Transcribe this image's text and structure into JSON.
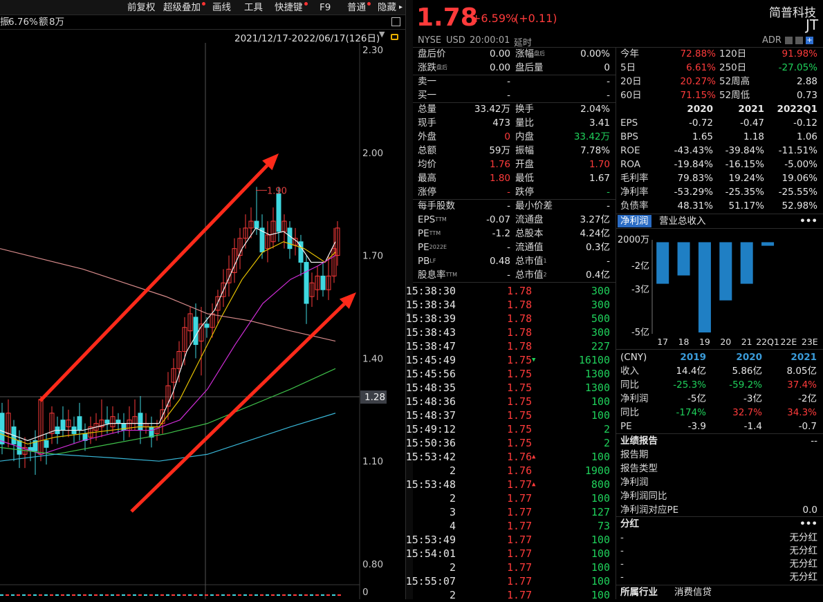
{
  "toolbar": {
    "items": [
      "前复权",
      "超级叠加",
      "画线",
      "工具",
      "快捷键",
      "F9",
      "普通",
      "隐藏"
    ]
  },
  "info_line": {
    "turnover_rate": "6.76%",
    "amount_label": "额",
    "amount": "8万",
    "prefix": "振"
  },
  "range_bar": {
    "range": "2021/12/17-2022/06/17(126日)"
  },
  "chart": {
    "y_ticks": [
      "2.30",
      "2.00",
      "1.70",
      "1.40",
      "1.10",
      "0.80",
      "0"
    ],
    "current_price_tag": "1.28",
    "high_marker": "1.90",
    "up_color": "#ff3b3b",
    "down_color": "#3fd8e0",
    "arrow_color": "#ff2a1a"
  },
  "quote": {
    "price": "1.78",
    "change_pct": "+6.59%",
    "change": "(+0.11)",
    "exchange": "NYSE",
    "currency": "USD",
    "time": "20:00:01",
    "delay": "延时",
    "name": "简普科技",
    "ticker": "JT",
    "adr": "ADR"
  },
  "left_table": [
    {
      "l1": "盘后价",
      "v1": "0.00",
      "c1": "white",
      "l2": "涨幅",
      "s2": "盘后",
      "v2": "0.00%",
      "c2": "white"
    },
    {
      "l1": "涨跌",
      "s1": "盘后",
      "v1": "0.00",
      "c1": "white",
      "l2": "盘后量",
      "v2": "0",
      "c2": "white"
    },
    {
      "l1": "卖一",
      "v1": "-",
      "c1": "white",
      "l2": "",
      "v2": "-",
      "c2": "white"
    },
    {
      "l1": "买一",
      "v1": "-",
      "c1": "white",
      "l2": "",
      "v2": "-",
      "c2": "white"
    },
    {
      "l1": "总量",
      "v1": "33.42万",
      "c1": "white",
      "l2": "换手",
      "v2": "2.04%",
      "c2": "white"
    },
    {
      "l1": "现手",
      "v1": "473",
      "c1": "white",
      "l2": "量比",
      "v2": "3.41",
      "c2": "white"
    },
    {
      "l1": "外盘",
      "v1": "0",
      "c1": "red",
      "l2": "内盘",
      "v2": "33.42万",
      "c2": "green"
    },
    {
      "l1": "总额",
      "v1": "59万",
      "c1": "white",
      "l2": "振幅",
      "v2": "7.78%",
      "c2": "white"
    },
    {
      "l1": "均价",
      "v1": "1.76",
      "c1": "red",
      "l2": "开盘",
      "v2": "1.70",
      "c2": "red"
    },
    {
      "l1": "最高",
      "v1": "1.80",
      "c1": "red",
      "l2": "最低",
      "v2": "1.67",
      "c2": "white"
    },
    {
      "l1": "涨停",
      "v1": "-",
      "c1": "red",
      "l2": "跌停",
      "v2": "-",
      "c2": "green"
    },
    {
      "l1": "每手股数",
      "v1": "-",
      "c1": "white",
      "l2": "最小价差",
      "v2": "-",
      "c2": "white"
    },
    {
      "l1": "EPS",
      "s1": "TTM",
      "v1": "-0.07",
      "c1": "white",
      "l2": "流通盘",
      "v2": "3.27亿",
      "c2": "white"
    },
    {
      "l1": "PE",
      "s1": "TTM",
      "v1": "-1.2",
      "c1": "white",
      "l2": "总股本",
      "v2": "4.24亿",
      "c2": "white"
    },
    {
      "l1": "PE",
      "s1": "2022E",
      "v1": "-",
      "c1": "white",
      "l2": "流通值",
      "v2": "0.3亿",
      "c2": "white"
    },
    {
      "l1": "PB",
      "s1": "LF",
      "v1": "0.48",
      "c1": "white",
      "l2": "总市值",
      "s2": "1",
      "v2": "-",
      "c2": "white"
    },
    {
      "l1": "股息率",
      "s1": "TTM",
      "v1": "-",
      "c1": "white",
      "l2": "总市值",
      "s2": "2",
      "v2": "0.4亿",
      "c2": "white"
    }
  ],
  "trades": [
    {
      "t": "15:38:30",
      "p": "1.78",
      "a": "",
      "v": "300"
    },
    {
      "t": "15:38:34",
      "p": "1.78",
      "a": "",
      "v": "300"
    },
    {
      "t": "15:38:39",
      "p": "1.78",
      "a": "",
      "v": "500"
    },
    {
      "t": "15:38:43",
      "p": "1.78",
      "a": "",
      "v": "300"
    },
    {
      "t": "15:38:47",
      "p": "1.78",
      "a": "",
      "v": "227"
    },
    {
      "t": "15:45:49",
      "p": "1.75",
      "a": "down",
      "v": "16100"
    },
    {
      "t": "15:45:56",
      "p": "1.75",
      "a": "",
      "v": "1300"
    },
    {
      "t": "15:48:35",
      "p": "1.75",
      "a": "",
      "v": "1300"
    },
    {
      "t": "15:48:36",
      "p": "1.75",
      "a": "",
      "v": "100"
    },
    {
      "t": "15:48:37",
      "p": "1.75",
      "a": "",
      "v": "100"
    },
    {
      "t": "15:49:12",
      "p": "1.75",
      "a": "",
      "v": "2"
    },
    {
      "t": "15:50:36",
      "p": "1.75",
      "a": "",
      "v": "2"
    },
    {
      "t": "15:53:42",
      "p": "1.76",
      "a": "up",
      "v": "100"
    },
    {
      "t": "2",
      "p": "1.76",
      "a": "",
      "v": "1900"
    },
    {
      "t": "15:53:48",
      "p": "1.77",
      "a": "up",
      "v": "800"
    },
    {
      "t": "2",
      "p": "1.77",
      "a": "",
      "v": "100"
    },
    {
      "t": "3",
      "p": "1.77",
      "a": "",
      "v": "127"
    },
    {
      "t": "4",
      "p": "1.77",
      "a": "",
      "v": "73"
    },
    {
      "t": "15:53:49",
      "p": "1.77",
      "a": "",
      "v": "100"
    },
    {
      "t": "15:54:01",
      "p": "1.77",
      "a": "",
      "v": "100"
    },
    {
      "t": "2",
      "p": "1.77",
      "a": "",
      "v": "100"
    },
    {
      "t": "15:55:07",
      "p": "1.77",
      "a": "",
      "v": "100"
    },
    {
      "t": "2",
      "p": "1.77",
      "a": "",
      "v": "100"
    }
  ],
  "perf": [
    {
      "l1": "今年",
      "v1": "72.88%",
      "c1": "red",
      "l2": "120日",
      "v2": "91.98%",
      "c2": "red"
    },
    {
      "l1": "5日",
      "v1": "6.61%",
      "c1": "red",
      "l2": "250日",
      "v2": "-27.05%",
      "c2": "green"
    },
    {
      "l1": "20日",
      "v1": "20.27%",
      "c1": "red",
      "l2": "52周高",
      "v2": "2.88",
      "c2": "white"
    },
    {
      "l1": "60日",
      "v1": "71.15%",
      "c1": "red",
      "l2": "52周低",
      "v2": "0.73",
      "c2": "white"
    }
  ],
  "fin_years": [
    "2020",
    "2021",
    "2022Q1"
  ],
  "fin": [
    {
      "l": "EPS",
      "v": [
        "-0.72",
        "-0.47",
        "-0.12"
      ]
    },
    {
      "l": "BPS",
      "v": [
        "1.65",
        "1.18",
        "1.06"
      ]
    },
    {
      "l": "ROE",
      "v": [
        "-43.43%",
        "-39.84%",
        "-11.51%"
      ]
    },
    {
      "l": "ROA",
      "v": [
        "-19.84%",
        "-16.15%",
        "-5.00%"
      ]
    },
    {
      "l": "毛利率",
      "v": [
        "79.83%",
        "19.24%",
        "19.06%"
      ]
    },
    {
      "l": "净利率",
      "v": [
        "-53.29%",
        "-25.35%",
        "-25.55%"
      ]
    },
    {
      "l": "负债率",
      "v": [
        "48.31%",
        "51.17%",
        "52.98%"
      ]
    }
  ],
  "bar_tabs": {
    "active": "净利润",
    "other": "营业总收入",
    "more": "•••"
  },
  "chart_data": {
    "type": "bar",
    "categories": [
      "17",
      "18",
      "19",
      "20",
      "21",
      "22Q1",
      "22E",
      "23E"
    ],
    "values": [
      -3.5,
      -2.8,
      -7.6,
      -4.9,
      -3.5,
      -0.3,
      null,
      null
    ],
    "y_ticks": [
      "2000万",
      "-2亿",
      "-3亿",
      "-5亿"
    ],
    "ylim": [
      -7.6,
      0.2
    ],
    "bar_color": "#1f7fc4"
  },
  "cny": {
    "label": "(CNY)",
    "years": [
      "2019",
      "2020",
      "2021"
    ],
    "rows": [
      {
        "l": "收入",
        "v": [
          "14.4亿",
          "5.86亿",
          "8.05亿"
        ],
        "c": [
          "white",
          "white",
          "white"
        ]
      },
      {
        "l": "同比",
        "v": [
          "-25.3%",
          "-59.2%",
          "37.4%"
        ],
        "c": [
          "green",
          "green",
          "red"
        ]
      },
      {
        "l": "净利润",
        "v": [
          "-5亿",
          "-3亿",
          "-2亿"
        ],
        "c": [
          "white",
          "white",
          "white"
        ]
      },
      {
        "l": "同比",
        "v": [
          "-174%",
          "32.7%",
          "34.3%"
        ],
        "c": [
          "green",
          "red",
          "red"
        ]
      },
      {
        "l": "PE",
        "v": [
          "-3.9",
          "-1.4",
          "-0.7"
        ],
        "c": [
          "white",
          "white",
          "white"
        ]
      }
    ]
  },
  "report": {
    "title": "业绩报告",
    "dash": "--",
    "items": [
      "报告期",
      "报告类型",
      "净利润",
      "净利润同比",
      "净利润对应PE"
    ],
    "last_value": "0.0"
  },
  "dividend": {
    "title": "分红",
    "more": "•••",
    "rows": [
      {
        "d": "-",
        "v": "无分红"
      },
      {
        "d": "-",
        "v": "无分红"
      },
      {
        "d": "-",
        "v": "无分红"
      },
      {
        "d": "-",
        "v": "无分红"
      }
    ]
  },
  "industry": {
    "label": "所属行业",
    "value": "消费信贷"
  }
}
